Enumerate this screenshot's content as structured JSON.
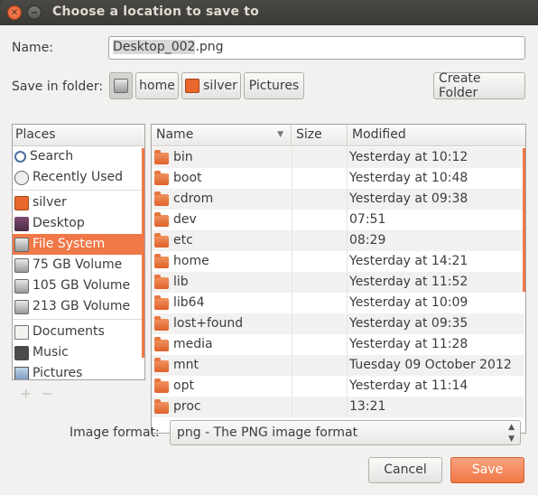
{
  "window": {
    "title": "Choose a location to save to"
  },
  "name_label": "Name:",
  "filename": {
    "selected": "Desktop_002",
    "ext": ".png"
  },
  "save_in_label": "Save in folder:",
  "path": [
    "home",
    "silver",
    "Pictures"
  ],
  "create_folder": "Create Folder",
  "places": {
    "header": "Places",
    "groups": [
      [
        {
          "label": "Search",
          "icon": "search-icon"
        },
        {
          "label": "Recently Used",
          "icon": "recent-icon"
        }
      ],
      [
        {
          "label": "silver",
          "icon": "home-folder-icon"
        },
        {
          "label": "Desktop",
          "icon": "desktop-icon"
        },
        {
          "label": "File System",
          "icon": "drive-icon",
          "selected": true
        },
        {
          "label": "75 GB Volume",
          "icon": "drive-icon"
        },
        {
          "label": "105 GB Volume",
          "icon": "drive-icon"
        },
        {
          "label": "213 GB Volume",
          "icon": "drive-icon"
        }
      ],
      [
        {
          "label": "Documents",
          "icon": "documents-icon"
        },
        {
          "label": "Music",
          "icon": "music-icon"
        },
        {
          "label": "Pictures",
          "icon": "pictures-icon"
        }
      ]
    ]
  },
  "files": {
    "columns": {
      "name": "Name",
      "size": "Size",
      "modified": "Modified"
    },
    "rows": [
      {
        "name": "bin",
        "size": "",
        "modified": "Yesterday at 10:12"
      },
      {
        "name": "boot",
        "size": "",
        "modified": "Yesterday at 10:48"
      },
      {
        "name": "cdrom",
        "size": "",
        "modified": "Yesterday at 09:38"
      },
      {
        "name": "dev",
        "size": "",
        "modified": "07:51"
      },
      {
        "name": "etc",
        "size": "",
        "modified": "08:29"
      },
      {
        "name": "home",
        "size": "",
        "modified": "Yesterday at 14:21"
      },
      {
        "name": "lib",
        "size": "",
        "modified": "Yesterday at 11:52"
      },
      {
        "name": "lib64",
        "size": "",
        "modified": "Yesterday at 10:09"
      },
      {
        "name": "lost+found",
        "size": "",
        "modified": "Yesterday at 09:35"
      },
      {
        "name": "media",
        "size": "",
        "modified": "Yesterday at 11:28"
      },
      {
        "name": "mnt",
        "size": "",
        "modified": "Tuesday 09 October 2012"
      },
      {
        "name": "opt",
        "size": "",
        "modified": "Yesterday at 11:14"
      },
      {
        "name": "proc",
        "size": "",
        "modified": "13:21"
      }
    ]
  },
  "format_label": "Image format:",
  "format_value": "png - The PNG image format",
  "buttons": {
    "cancel": "Cancel",
    "save": "Save"
  },
  "colors": {
    "accent": "#f07746",
    "title_bar": "#3c3b37",
    "dialog_bg": "#f2f1f0"
  }
}
